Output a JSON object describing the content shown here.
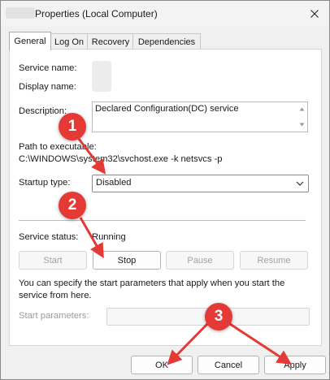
{
  "window": {
    "title": "Properties (Local Computer)"
  },
  "tabs": [
    {
      "label": "General",
      "active": true
    },
    {
      "label": "Log On",
      "active": false
    },
    {
      "label": "Recovery",
      "active": false
    },
    {
      "label": "Dependencies",
      "active": false
    }
  ],
  "general": {
    "service_name_label": "Service name:",
    "display_name_label": "Display name:",
    "description_label": "Description:",
    "description_value": "Declared Configuration(DC) service",
    "path_label": "Path to executable:",
    "path_value": "C:\\WINDOWS\\system32\\svchost.exe -k netsvcs -p",
    "startup_type_label": "Startup type:",
    "startup_type_value": "Disabled",
    "service_status_label": "Service status:",
    "service_status_value": "Running",
    "buttons": {
      "start": "Start",
      "stop": "Stop",
      "pause": "Pause",
      "resume": "Resume"
    },
    "help_text": "You can specify the start parameters that apply when you start the service from here.",
    "start_params_label": "Start parameters:",
    "start_params_value": ""
  },
  "footer": {
    "ok": "OK",
    "cancel": "Cancel",
    "apply": "Apply"
  },
  "annotations": {
    "marker_1": "1",
    "marker_2": "2",
    "marker_3": "3",
    "color": "#e53935"
  }
}
